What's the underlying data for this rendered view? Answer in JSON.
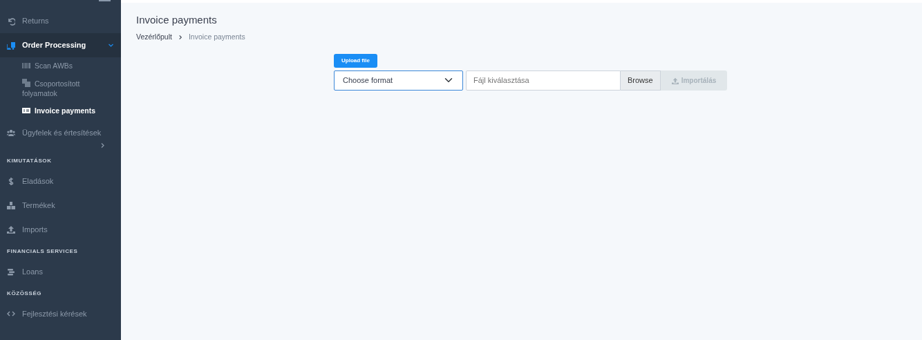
{
  "sidebar": {
    "items": [
      {
        "kind": "item",
        "label": "Returns",
        "selected": false
      },
      {
        "kind": "item",
        "label": "Order Processing",
        "selected": true,
        "expanded": true,
        "children": [
          {
            "label": "Scan AWBs",
            "selected": false
          },
          {
            "label": "Csoportosított folyamatok",
            "selected": false
          },
          {
            "label": "Invoice payments",
            "selected": true
          }
        ]
      },
      {
        "kind": "item",
        "label": "Ügyfelek és értesítések",
        "selected": false,
        "expanded": false
      },
      {
        "kind": "section",
        "label": "KIMUTATÁSOK"
      },
      {
        "kind": "item",
        "label": "Eladások",
        "selected": false
      },
      {
        "kind": "item",
        "label": "Termékek",
        "selected": false
      },
      {
        "kind": "item",
        "label": "Imports",
        "selected": false
      },
      {
        "kind": "section",
        "label": "FINANCIALS SERVICES"
      },
      {
        "kind": "item",
        "label": "Loans",
        "selected": false
      },
      {
        "kind": "section",
        "label": "KÖZÖSSÉG"
      },
      {
        "kind": "item",
        "label": "Fejlesztési kérések",
        "selected": false
      }
    ]
  },
  "page": {
    "title": "Invoice payments",
    "breadcrumb": [
      "Vezérlőpult",
      "Invoice payments"
    ]
  },
  "upload": {
    "badge": "Upload file",
    "format_select": {
      "value": "Choose format"
    },
    "file_field": {
      "placeholder": "Fájl kiválasztása"
    },
    "browse_button": "Browse",
    "import_button": {
      "label": "Importálás",
      "disabled": true
    }
  }
}
